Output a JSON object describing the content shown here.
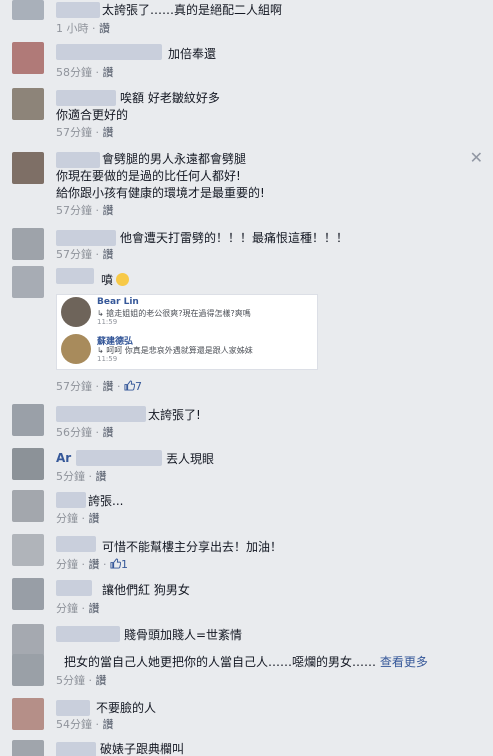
{
  "comments": [
    {
      "text": "太誇張了……真的是絕配二人組啊",
      "time": "1 小時",
      "reply": "讚",
      "likes": ""
    },
    {
      "text": "加倍奉還",
      "time": "58分鐘",
      "reply": "讚",
      "likes": ""
    },
    {
      "text": "唉額 好老皺紋好多",
      "text2": "你適合更好的",
      "time": "57分鐘",
      "reply": "讚",
      "likes": ""
    },
    {
      "text": "會劈腿的男人永遠都會劈腿",
      "text2": "你現在要做的是過的比任何人都好!",
      "text3": "給你跟小孩有健康的環境才是最重要的!",
      "time": "57分鐘",
      "reply": "讚",
      "likes": ""
    },
    {
      "text": "他會遭天打雷劈的！！！最痛恨這種！！！",
      "time": "57分鐘",
      "reply": "讚",
      "likes": ""
    },
    {
      "text": "噴",
      "time": "57分鐘",
      "reply": "讚",
      "likes": "7",
      "embed": [
        {
          "name": "Bear Lin",
          "text": "↳ 搶走姐姐的老公很爽?現在過得怎樣?爽嗎",
          "time": "11:59"
        },
        {
          "name": "蘇建德弘",
          "text": "↳ 呵呵 你真是悲哀外遇就算還是跟人家姊妹",
          "time": "11:59"
        }
      ]
    },
    {
      "text": "太誇張了!",
      "time": "56分鐘",
      "reply": "讚",
      "likes": ""
    },
    {
      "name_prefix": "Ar",
      "text": "丟人現眼",
      "time": "5分鐘",
      "reply": "讚",
      "likes": ""
    },
    {
      "text": "誇張...",
      "time": "分鐘",
      "reply": "讚",
      "likes": ""
    },
    {
      "text": "可惜不能幫樓主分享出去！加油！",
      "time": "分鐘",
      "reply": "讚",
      "likes": "1"
    },
    {
      "text": "讓他們紅 狗男女",
      "time": "分鐘",
      "reply": "讚",
      "likes": ""
    },
    {
      "text": "賤骨頭加賤人=世紊情",
      "time": "分鐘",
      "reply": "讚",
      "likes": ""
    },
    {
      "text": "把女的當自己人她更把你的人當自己人……噁爛的男女……",
      "see_more": "查看更多",
      "time": "5分鐘",
      "reply": "讚",
      "likes": ""
    },
    {
      "text": "不要臉的人",
      "time": "54分鐘",
      "reply": "讚",
      "likes": ""
    },
    {
      "text": "破婊子跟典欄叫",
      "time": "",
      "reply": "",
      "likes": ""
    }
  ],
  "colors": {
    "background": "#e9ebee",
    "link": "#365899",
    "meta": "#90949c"
  }
}
